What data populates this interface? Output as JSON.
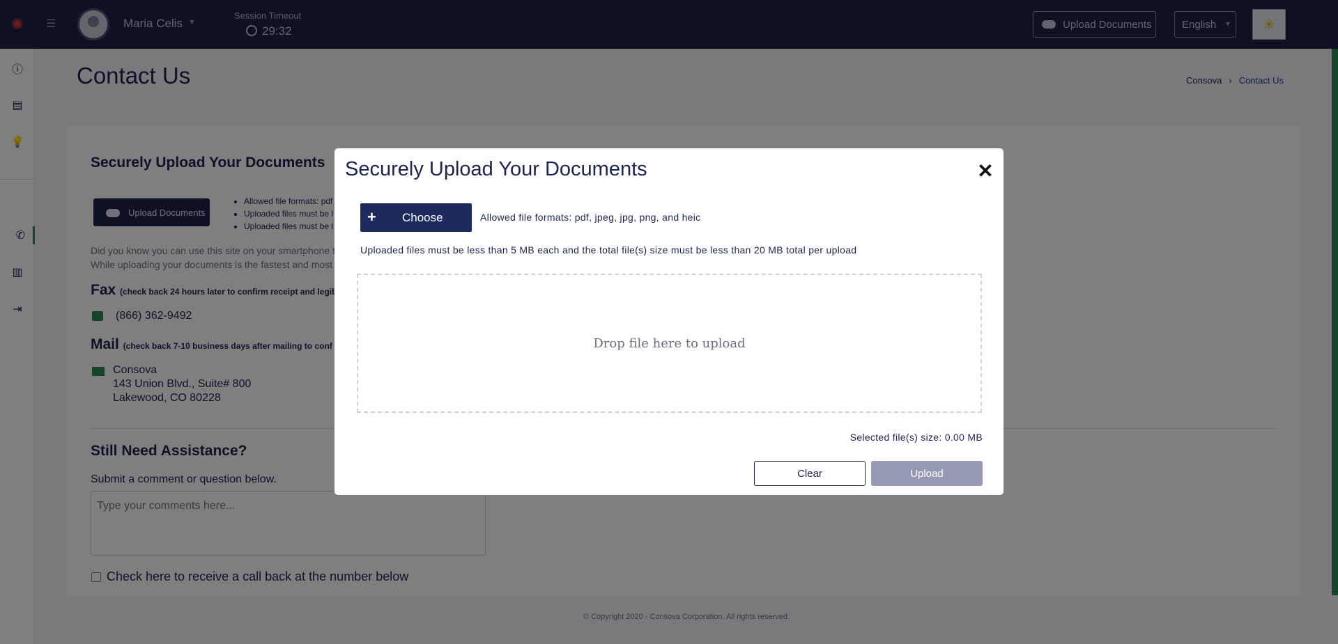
{
  "header": {
    "user_name": "Maria Celis",
    "session_label": "Session Timeout",
    "session_time": "29:32",
    "upload_label": "Upload Documents",
    "language": "English"
  },
  "page": {
    "title": "Contact Us",
    "breadcrumb": [
      "Consova",
      "Contact Us"
    ]
  },
  "card": {
    "section_title": "Securely Upload Your Documents",
    "upload_button": "Upload Documents",
    "bullets": [
      "Allowed file formats: pdf",
      "Uploaded files must be l",
      "Uploaded files must be l"
    ],
    "body_line1": "Did you know you can use this site on your smartphone t",
    "body_line2": "While uploading your documents is the fastest and most",
    "fax_head": "Fax",
    "fax_note": "(check back 24 hours later to confirm receipt and legib",
    "fax_number": "(866) 362-9492",
    "mail_head": "Mail",
    "mail_note": "(check back 7-10 business days after mailing to conf",
    "address": [
      "Consova",
      "143 Union Blvd., Suite# 800",
      "Lakewood, CO 80228"
    ],
    "assist_head": "Still Need Assistance?",
    "assist_sub": "Submit a comment or question below.",
    "comment_placeholder": "Type your comments here...",
    "callback_label": "Check here to receive a call back at the number below"
  },
  "footer": "© Copyright 2020 - Consova Corporation. All rights reserved.",
  "modal": {
    "title": "Securely Upload Your Documents",
    "close": "✕",
    "choose_label": "Choose",
    "formats": "Allowed file formats: pdf, jpeg, jpg, png, and heic",
    "size_rule": "Uploaded files must be less than 5 MB each and the total file(s) size must be less than 20 MB total per upload",
    "drop_text": "Drop file here to upload",
    "selected_size": "Selected file(s) size: 0.00 MB",
    "clear_label": "Clear",
    "upload_label": "Upload"
  },
  "colors": {
    "navy": "#1c2346",
    "accent_green": "#2c8a52",
    "disabled_button": "#9599b4"
  }
}
